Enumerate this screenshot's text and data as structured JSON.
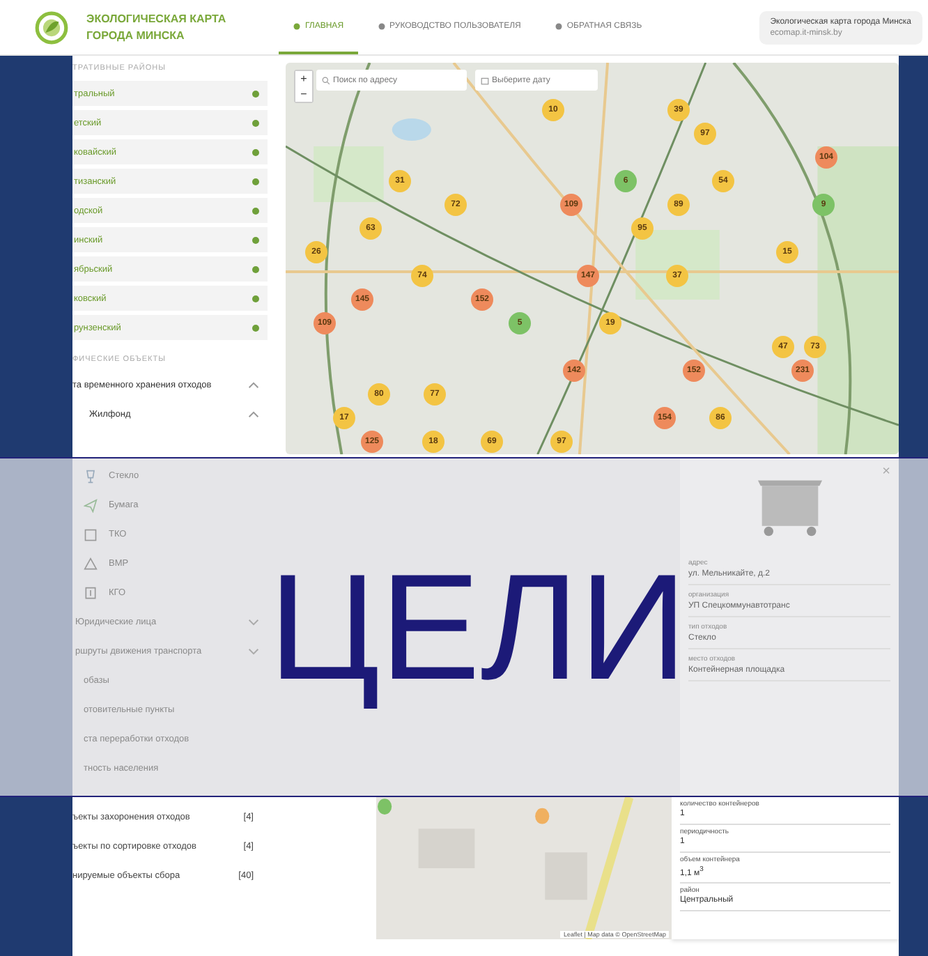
{
  "header": {
    "title_lines": [
      "ЭКОЛОГИЧЕСКАЯ КАРТА",
      "ГОРОДА МИНСКА"
    ],
    "tabs": [
      {
        "label": "ГЛАВНАЯ",
        "selected": true
      },
      {
        "label": "РУКОВОДСТВО ПОЛЬЗОВАТЕЛЯ",
        "selected": false
      },
      {
        "label": "ОБРАТНАЯ СВЯЗЬ",
        "selected": false
      }
    ],
    "site_card": {
      "title": "Экологическая карта города Минска",
      "url": "ecomap.it-minsk.by"
    }
  },
  "sidebar": {
    "districts_heading": "ТРАТИВНЫЕ РАЙОНЫ",
    "districts": [
      {
        "label": "тральный"
      },
      {
        "label": "етский"
      },
      {
        "label": "ковайский"
      },
      {
        "label": "тизанский"
      },
      {
        "label": "одской"
      },
      {
        "label": "инский"
      },
      {
        "label": "ябрьский"
      },
      {
        "label": "ковский"
      },
      {
        "label": "рунзенский"
      }
    ],
    "objects_heading": "ФИЧЕСКИЕ ОБЪЕКТЫ",
    "groups": [
      {
        "label": "та временного хранения отходов",
        "expanded": true
      },
      {
        "label": "Жилфонд",
        "expanded": true
      }
    ]
  },
  "map": {
    "zoom_in": "+",
    "zoom_out": "−",
    "search": {
      "placeholder": "Поиск по адресу"
    },
    "date": {
      "placeholder": "Выберите дату"
    },
    "clusters": [
      {
        "count": "10",
        "color": "#f3c443"
      },
      {
        "count": "39",
        "color": "#f3c443"
      },
      {
        "count": "97",
        "color": "#f3c443"
      },
      {
        "count": "104",
        "color": "#ee8a5c"
      },
      {
        "count": "31",
        "color": "#f3c443"
      },
      {
        "count": "6",
        "color": "#7dc266"
      },
      {
        "count": "54",
        "color": "#f3c443"
      },
      {
        "count": "72",
        "color": "#f3c443"
      },
      {
        "count": "109",
        "color": "#ee8a5c"
      },
      {
        "count": "89",
        "color": "#f3c443"
      },
      {
        "count": "9",
        "color": "#7dc266"
      },
      {
        "count": "63",
        "color": "#f3c443"
      },
      {
        "count": "95",
        "color": "#f3c443"
      },
      {
        "count": "26",
        "color": "#f3c443"
      },
      {
        "count": "15",
        "color": "#f3c443"
      },
      {
        "count": "74",
        "color": "#f3c443"
      },
      {
        "count": "147",
        "color": "#ee8a5c"
      },
      {
        "count": "37",
        "color": "#f3c443"
      },
      {
        "count": "145",
        "color": "#ee8a5c"
      },
      {
        "count": "152",
        "color": "#ee8a5c"
      },
      {
        "count": "109",
        "color": "#ee8a5c"
      },
      {
        "count": "5",
        "color": "#7dc266"
      },
      {
        "count": "19",
        "color": "#f3c443"
      },
      {
        "count": "47",
        "color": "#f3c443"
      },
      {
        "count": "73",
        "color": "#f3c443"
      },
      {
        "count": "142",
        "color": "#ee8a5c"
      },
      {
        "count": "152",
        "color": "#ee8a5c"
      },
      {
        "count": "231",
        "color": "#ee8a5c"
      },
      {
        "count": "80",
        "color": "#f3c443"
      },
      {
        "count": "77",
        "color": "#f3c443"
      },
      {
        "count": "17",
        "color": "#f3c443"
      },
      {
        "count": "154",
        "color": "#ee8a5c"
      },
      {
        "count": "86",
        "color": "#f3c443"
      },
      {
        "count": "125",
        "color": "#ee8a5c"
      },
      {
        "count": "18",
        "color": "#f3c443"
      },
      {
        "count": "69",
        "color": "#f3c443"
      },
      {
        "count": "97",
        "color": "#f3c443"
      }
    ]
  },
  "slide_title": "ЦЕЛИ",
  "band_sidebar": [
    {
      "kind": "waste",
      "label": "Стекло"
    },
    {
      "kind": "waste",
      "label": "Бумага"
    },
    {
      "kind": "waste",
      "label": "ТКО"
    },
    {
      "kind": "waste",
      "label": "ВМР"
    },
    {
      "kind": "waste",
      "label": "КГО"
    },
    {
      "kind": "group",
      "label": "Юридические лица",
      "expanded": false
    },
    {
      "kind": "group",
      "label": "ршруты движения транспорта",
      "expanded": false
    },
    {
      "kind": "layer",
      "label": "обазы"
    },
    {
      "kind": "layer",
      "label": "отовительные пункты"
    },
    {
      "kind": "layer",
      "label": "ста переработки отходов"
    },
    {
      "kind": "layer",
      "label": "тность населения"
    }
  ],
  "popup_upper_fields": [
    {
      "label": "адрес",
      "value": "ул. Мельникайте, д.2"
    },
    {
      "label": "организация",
      "value": "УП Спецкоммунавтотранс"
    },
    {
      "label": "тип отходов",
      "value": "Стекло"
    },
    {
      "label": "место отходов",
      "value": "Контейнерная площадка"
    }
  ],
  "popup_close": "×",
  "lower_sidebar": [
    {
      "label": "ъекты захоронения отходов",
      "count": "[4]"
    },
    {
      "label": "ъекты по сортировке отходов",
      "count": "[4]"
    },
    {
      "label": "нируемые объекты сбора",
      "count": "[40]"
    }
  ],
  "popup_lower_fields": [
    {
      "label": "количество контейнеров",
      "value": "1"
    },
    {
      "label": "периодичность",
      "value": "1"
    },
    {
      "label": "объем контейнера",
      "value": "1,1 м$^{3}$"
    },
    {
      "label": "район",
      "value": "Центральный"
    }
  ],
  "map_attribution": "Leaflet | Map data © OpenStreetMap"
}
